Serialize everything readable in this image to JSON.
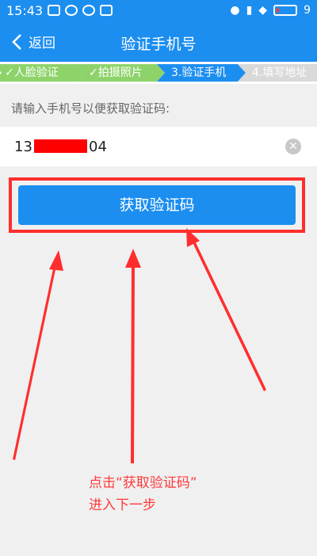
{
  "status": {
    "time": "15:43",
    "battery": "9"
  },
  "appbar": {
    "back_label": "返回",
    "title": "验证手机号"
  },
  "steps": [
    {
      "label": "✓人脸验证",
      "state": "done"
    },
    {
      "label": "✓拍摄照片",
      "state": "done"
    },
    {
      "label": "3.验证手机",
      "state": "current"
    },
    {
      "label": "4.填写地址",
      "state": "todo"
    }
  ],
  "form": {
    "hint": "请输入手机号以便获取验证码:",
    "phone_prefix": "13",
    "phone_suffix": "04",
    "clear_icon": "✕",
    "submit_label": "获取验证码"
  },
  "annotation": {
    "line1": "点击“获取验证码”",
    "line2": "进入下一步"
  },
  "colors": {
    "primary": "#1c8ef0",
    "done": "#8dd36a",
    "todo": "#d9d9d9",
    "annotation": "#ff2e2e"
  }
}
